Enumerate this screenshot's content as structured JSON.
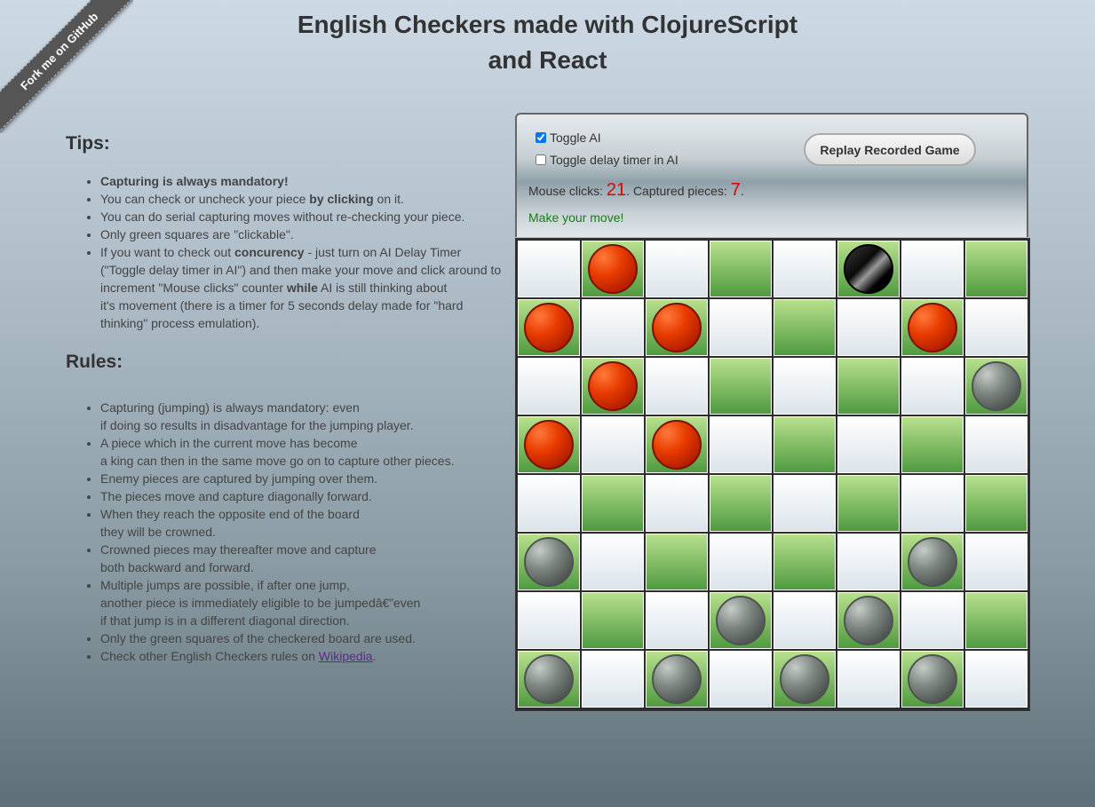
{
  "ribbon": {
    "label": "Fork me on GitHub"
  },
  "header": {
    "title_line1": "English Checkers made with ClojureScript",
    "title_line2": "and React"
  },
  "tips": {
    "heading": "Tips:",
    "items": [
      {
        "segments": [
          {
            "text": "Capturing is always mandatory!",
            "bold": true
          }
        ]
      },
      {
        "segments": [
          {
            "text": "You can check or uncheck your piece ",
            "bold": false
          },
          {
            "text": "by clicking",
            "bold": true
          },
          {
            "text": " on it.",
            "bold": false
          }
        ]
      },
      {
        "segments": [
          {
            "text": "You can do serial capturing moves without re-checking your piece.",
            "bold": false
          }
        ]
      },
      {
        "segments": [
          {
            "text": "Only green squares are \"clickable\".",
            "bold": false
          }
        ]
      },
      {
        "segments": [
          {
            "text": "If you want to check out ",
            "bold": false
          },
          {
            "text": "concurency",
            "bold": true
          },
          {
            "text": " - just turn on AI Delay Timer\n(\"Toggle delay timer in AI\") and then make your move and click around to\nincrement \"Mouse clicks\" counter ",
            "bold": false
          },
          {
            "text": "while",
            "bold": true
          },
          {
            "text": " AI is still thinking about\nit's movement (there is a timer for 5 seconds delay made for \"hard\nthinking\" process emulation).",
            "bold": false
          }
        ]
      }
    ]
  },
  "rules": {
    "heading": "Rules:",
    "items": [
      "Capturing (jumping) is always mandatory: even\nif doing so results in disadvantage for the jumping player.",
      "A piece which in the current move has become\na king can then in the same move go on to capture other pieces.",
      "Enemy pieces are captured by jumping over them.",
      "The pieces move and capture diagonally forward.",
      "When they reach the opposite end of the board\nthey will be crowned.",
      "Crowned pieces may thereafter move and capture\nboth backward and forward.",
      "Multiple jumps are possible, if after one jump,\nanother piece is immediately eligible to be jumpedâ€”even\nif that jump is in a different diagonal direction.",
      "Only the green squares of the checkered board are used."
    ],
    "last_prefix": "Check other English Checkers rules on ",
    "last_link": "Wikipedia",
    "last_suffix": "."
  },
  "controls": {
    "toggle_ai_label": "Toggle AI",
    "toggle_ai_checked": true,
    "toggle_delay_label": "Toggle delay timer in AI",
    "toggle_delay_checked": false,
    "replay_label": "Replay Recorded Game",
    "mouse_clicks_label": "Mouse clicks: ",
    "mouse_clicks": "21",
    "captured_label": ". Captured pieces: ",
    "captured": "7",
    "captured_suffix": ".",
    "status": "Make your move!"
  },
  "colors": {
    "red_piece": "#e83b00",
    "gray_piece": "#7e8681",
    "green_square": "#4f9a3f",
    "light_square": "#dbe4ea",
    "status_text": "#1b7a1b",
    "counter_text": "#dd0000"
  },
  "board": {
    "rows": [
      [
        null,
        "red",
        null,
        null,
        null,
        "black",
        null,
        null
      ],
      [
        "red",
        null,
        "red",
        null,
        null,
        null,
        "red",
        null
      ],
      [
        null,
        "red",
        null,
        null,
        null,
        null,
        null,
        "gray"
      ],
      [
        "red",
        null,
        "red",
        null,
        null,
        null,
        null,
        null
      ],
      [
        null,
        null,
        null,
        null,
        null,
        null,
        null,
        null
      ],
      [
        "gray",
        null,
        null,
        null,
        null,
        null,
        "gray",
        null
      ],
      [
        null,
        null,
        null,
        "gray",
        null,
        "gray",
        null,
        null
      ],
      [
        "gray",
        null,
        "gray",
        null,
        "gray",
        null,
        "gray",
        null
      ]
    ]
  }
}
